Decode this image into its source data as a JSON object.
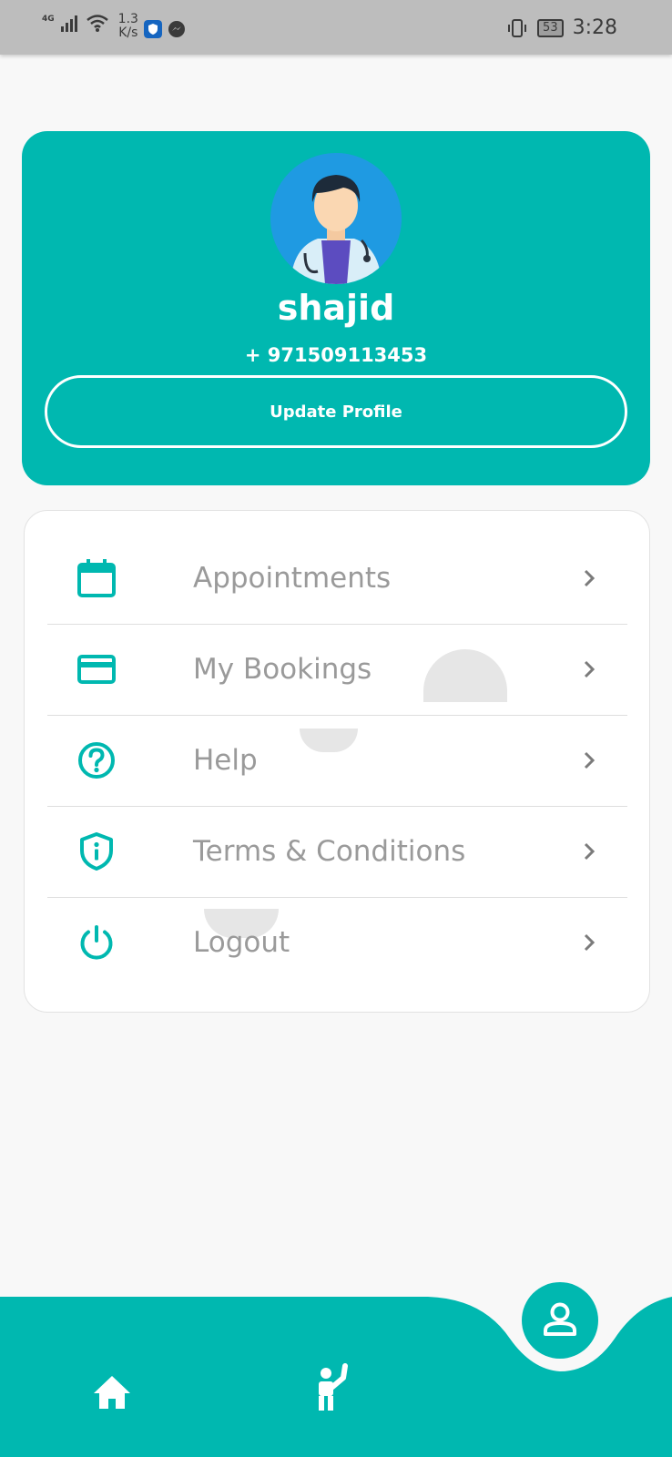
{
  "status_bar": {
    "network": "4G",
    "speed_value": "1.3",
    "speed_unit": "K/s",
    "battery": "53",
    "time": "3:28"
  },
  "profile": {
    "name": "shajid",
    "phone": "+ 971509113453",
    "update_button": "Update Profile"
  },
  "menu": {
    "items": [
      {
        "label": "Appointments",
        "icon": "calendar-icon"
      },
      {
        "label": "My Bookings",
        "icon": "credit-card-icon"
      },
      {
        "label": "Help",
        "icon": "help-circle-icon"
      },
      {
        "label": "Terms & Conditions",
        "icon": "shield-info-icon"
      },
      {
        "label": "Logout",
        "icon": "power-icon"
      }
    ]
  },
  "bottom_nav": {
    "items": [
      {
        "icon": "home-icon"
      },
      {
        "icon": "person-waving-icon"
      },
      {
        "icon": "profile-icon",
        "active": true
      }
    ]
  },
  "colors": {
    "accent": "#00b8b0",
    "label_gray": "#9a9a9a",
    "background": "#f8f8f8"
  }
}
